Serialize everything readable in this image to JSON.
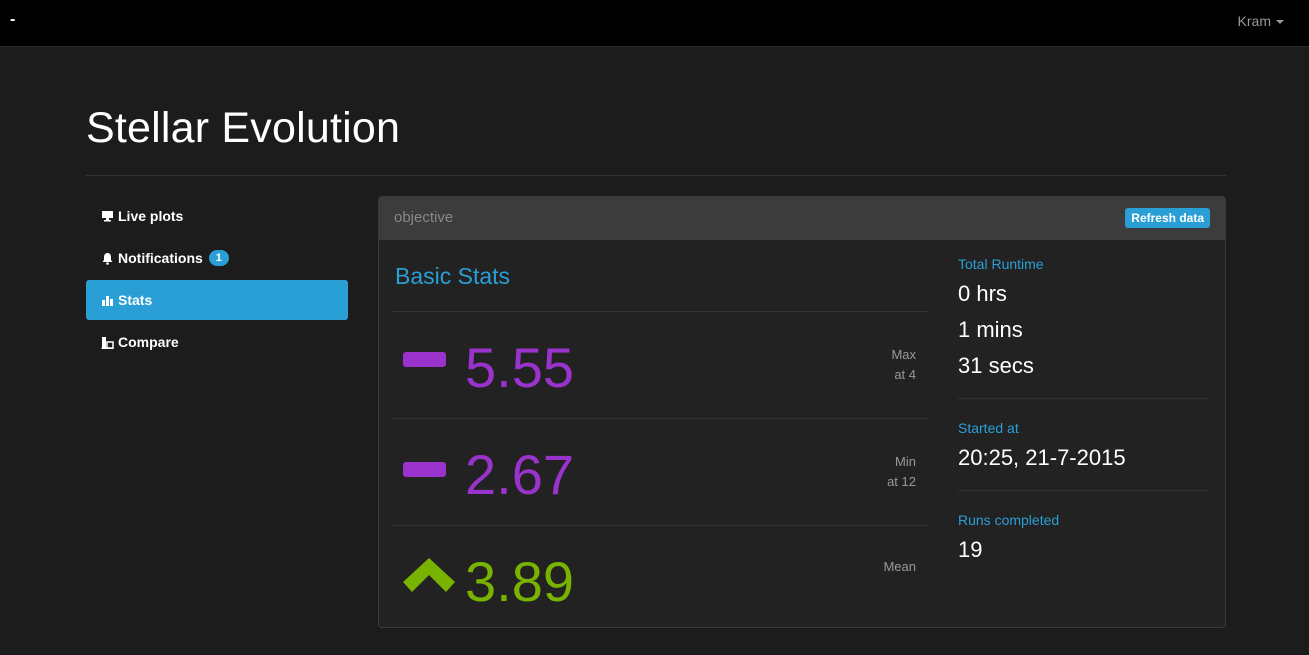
{
  "navbar": {
    "brand": "-",
    "user": "Kram"
  },
  "page": {
    "title": "Stellar Evolution"
  },
  "sidebar": {
    "items": [
      {
        "label": "Live plots",
        "icon": "monitor-icon",
        "active": false
      },
      {
        "label": "Notifications",
        "icon": "bell-icon",
        "active": false,
        "badge": "1"
      },
      {
        "label": "Stats",
        "icon": "bar-chart-icon",
        "active": true
      },
      {
        "label": "Compare",
        "icon": "compare-icon",
        "active": false
      }
    ]
  },
  "panel": {
    "title": "objective",
    "refresh_label": "Refresh data",
    "basic_stats_heading": "Basic Stats",
    "stats": [
      {
        "icon": "dash-icon",
        "value": "5.55",
        "label_line1": "Max",
        "label_line2": "at 4",
        "color": "#9933cc"
      },
      {
        "icon": "dash-icon",
        "value": "2.67",
        "label_line1": "Min",
        "label_line2": "at 12",
        "color": "#9933cc"
      },
      {
        "icon": "chevron-up-icon",
        "value": "3.89",
        "label_line1": "Mean",
        "label_line2": "",
        "color": "#77b300"
      }
    ],
    "runtime": {
      "label": "Total Runtime",
      "hours": "0 hrs",
      "minutes": "1 mins",
      "seconds": "31 secs"
    },
    "started": {
      "label": "Started at",
      "value": "20:25, 21-7-2015"
    },
    "runs": {
      "label": "Runs completed",
      "value": "19"
    }
  },
  "colors": {
    "accent": "#2a9fd6",
    "purple": "#9933cc",
    "green": "#77b300"
  }
}
